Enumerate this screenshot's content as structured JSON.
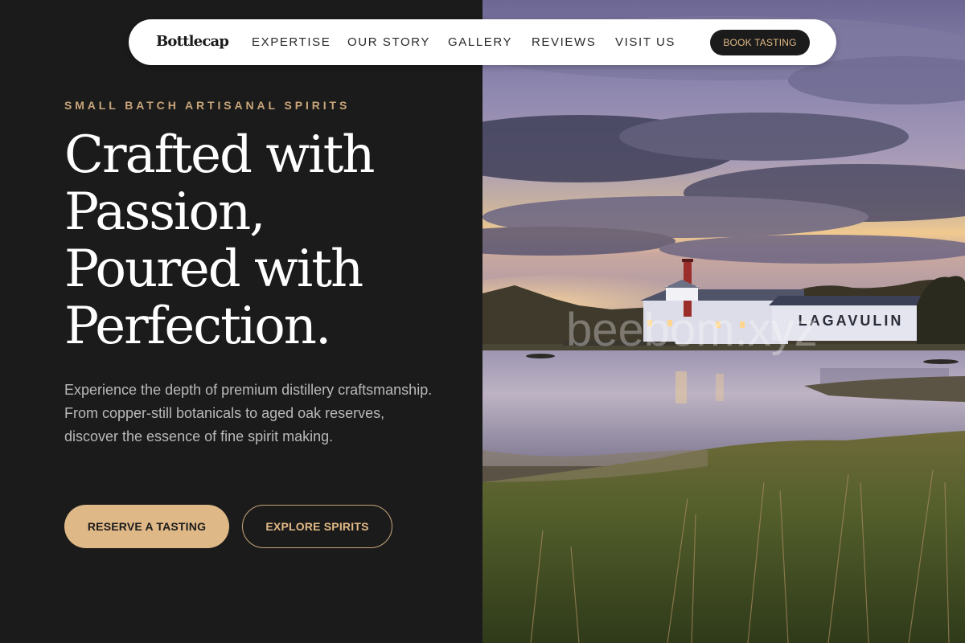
{
  "brand": {
    "name": "Bottlecap"
  },
  "nav": {
    "links": [
      "EXPERTISE",
      "OUR STORY",
      "GALLERY",
      "REVIEWS",
      "VISIT US"
    ],
    "cta_label": "BOOK TASTING"
  },
  "hero": {
    "eyebrow": "SMALL BATCH ARTISANAL SPIRITS",
    "headline_lines": [
      "Crafted with",
      "Passion,",
      "Poured with",
      "Perfection."
    ],
    "description": "Experience the depth of premium distillery craftsmanship. From copper-still botanicals to aged oak reserves, discover the essence of fine spirit making.",
    "primary_button": "RESERVE A TASTING",
    "secondary_button": "EXPLORE SPIRITS"
  },
  "photo": {
    "subject": "distillery-by-the-water-at-dusk",
    "building_sign": "LAGAVULIN",
    "watermark": "beebom.xyz"
  },
  "colors": {
    "page_bg": "#1b1b1b",
    "accent_gold": "#dfb887",
    "eyebrow_gold": "#c9a57a",
    "nav_bg": "#ffffff",
    "text_light": "#ffffff",
    "text_muted": "#b9b9b9"
  }
}
